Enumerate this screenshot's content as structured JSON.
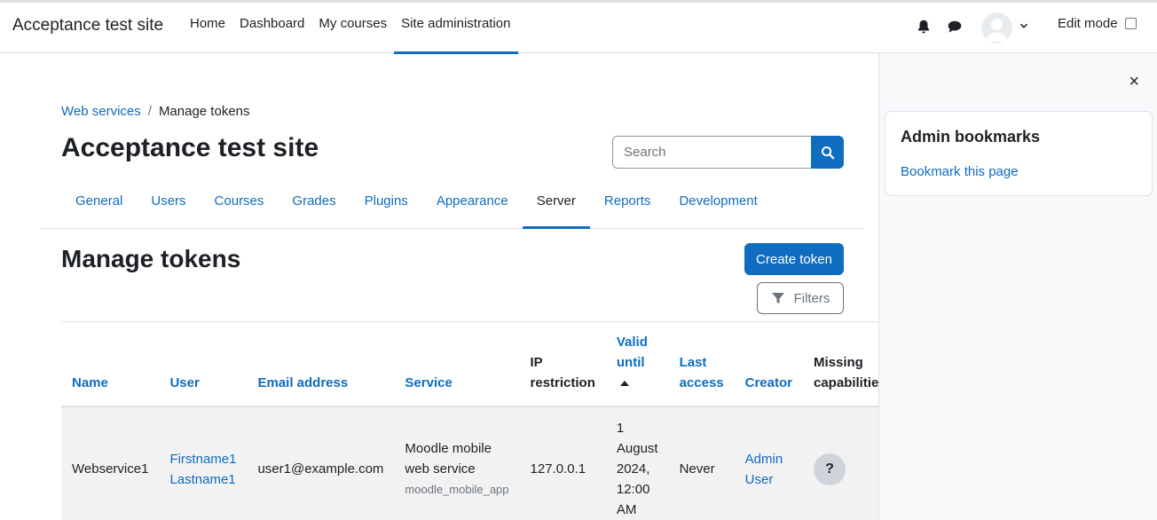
{
  "site_name": "Acceptance test site",
  "primary_nav": [
    {
      "label": "Home",
      "active": false
    },
    {
      "label": "Dashboard",
      "active": false
    },
    {
      "label": "My courses",
      "active": false
    },
    {
      "label": "Site administration",
      "active": true
    }
  ],
  "user_menu": {
    "edit_mode_label": "Edit mode",
    "edit_mode_checked": false
  },
  "breadcrumb": {
    "parent": "Web services",
    "separator": "/",
    "current": "Manage tokens"
  },
  "page_title": "Acceptance test site",
  "search": {
    "placeholder": "Search",
    "value": ""
  },
  "secondary_nav": [
    {
      "label": "General",
      "active": false
    },
    {
      "label": "Users",
      "active": false
    },
    {
      "label": "Courses",
      "active": false
    },
    {
      "label": "Grades",
      "active": false
    },
    {
      "label": "Plugins",
      "active": false
    },
    {
      "label": "Appearance",
      "active": false
    },
    {
      "label": "Server",
      "active": true
    },
    {
      "label": "Reports",
      "active": false
    },
    {
      "label": "Development",
      "active": false
    }
  ],
  "section_title": "Manage tokens",
  "buttons": {
    "create_token": "Create token",
    "filters": "Filters"
  },
  "table": {
    "headers": {
      "name": "Name",
      "user": "User",
      "email": "Email address",
      "service": "Service",
      "ip_line1": "IP",
      "ip_line2": "restriction",
      "valid_line1": "Valid",
      "valid_line2": "until",
      "last_line1": "Last",
      "last_line2": "access",
      "creator": "Creator",
      "missing_line1": "Missing",
      "missing_line2": "capabilities"
    },
    "rows": [
      {
        "name": "Webservice1",
        "user_first": "Firstname1",
        "user_last": "Lastname1",
        "email": "user1@example.com",
        "service_line1": "Moodle mobile",
        "service_line2": "web service",
        "service_short": "moodle_mobile_app",
        "ip": "127.0.0.1",
        "valid_l1": "1",
        "valid_l2": "August",
        "valid_l3": "2024,",
        "valid_l4": "12:00",
        "valid_l5": "AM",
        "last_access": "Never",
        "creator_first": "Admin",
        "creator_last": "User",
        "missing": "?"
      }
    ]
  },
  "drawer": {
    "close": "×",
    "card_title": "Admin bookmarks",
    "bookmark_link": "Bookmark this page"
  },
  "colors": {
    "primary": "#0f6cbf",
    "text": "#1d2125",
    "muted": "#6a737b",
    "row_bg": "#f2f2f2"
  }
}
